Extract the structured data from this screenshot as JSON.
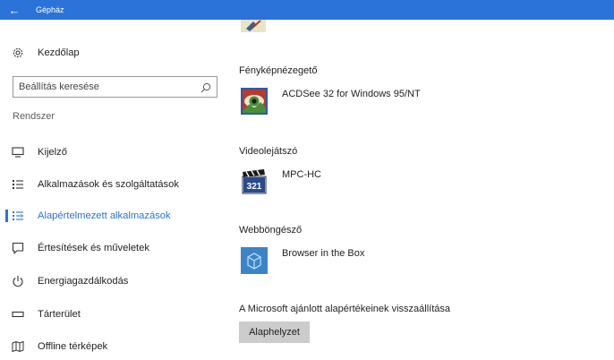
{
  "window": {
    "title": "Gépház",
    "back_glyph": "←"
  },
  "sidebar": {
    "home_label": "Kezdőlap",
    "search_placeholder": "Beállítás keresése",
    "section_label": "Rendszer",
    "items": [
      {
        "label": "Kijelző",
        "icon": "monitor-icon",
        "active": false
      },
      {
        "label": "Alkalmazások és szolgáltatások",
        "icon": "apps-list-icon",
        "active": false
      },
      {
        "label": "Alapértelmezett alkalmazások",
        "icon": "default-apps-icon",
        "active": true
      },
      {
        "label": "Értesítések és műveletek",
        "icon": "notification-icon",
        "active": false
      },
      {
        "label": "Energiagazdálkodás",
        "icon": "power-icon",
        "active": false
      },
      {
        "label": "Tárterület",
        "icon": "storage-icon",
        "active": false
      },
      {
        "label": "Offline térképek",
        "icon": "map-icon",
        "active": false
      }
    ]
  },
  "main": {
    "categories": [
      {
        "title": "Fényképnézegető",
        "app": "ACDSee 32 for Windows 95/NT",
        "icon": "acdsee-icon"
      },
      {
        "title": "Videolejátszó",
        "app": "MPC-HC",
        "icon": "mpc-hc-icon"
      },
      {
        "title": "Webböngésző",
        "app": "Browser in the Box",
        "icon": "browser-box-icon"
      }
    ],
    "reset_label": "A Microsoft ajánlott alapértékeinek visszaállítása",
    "reset_button": "Alaphelyzet"
  },
  "colors": {
    "accent": "#2b73d8",
    "button_bg": "#cccccc"
  }
}
